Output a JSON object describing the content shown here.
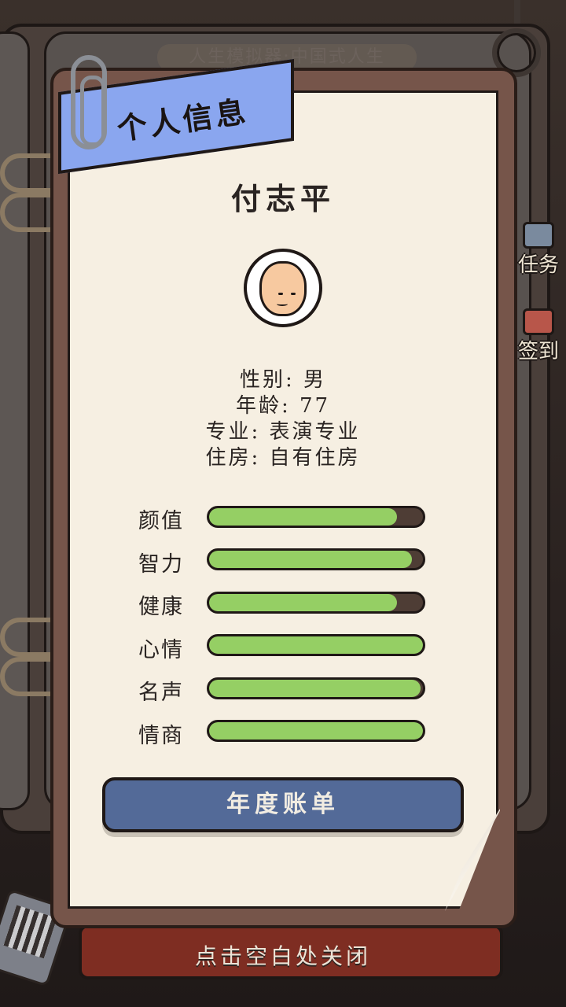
{
  "background": {
    "game_title": "人生模拟器:中国式人生",
    "side_buttons": [
      {
        "label": "任务",
        "icon": "clipboard-icon"
      },
      {
        "label": "签到",
        "icon": "pencil-icon"
      }
    ],
    "close_hint": "点击空白处关闭"
  },
  "panel": {
    "title": "个人信息",
    "name": "付志平",
    "avatar": "old-man-avatar-icon",
    "info": [
      {
        "label": "性别:",
        "value": "男"
      },
      {
        "label": "年龄:",
        "value": "77"
      },
      {
        "label": "专业:",
        "value": "表演专业"
      },
      {
        "label": "住房:",
        "value": "自有住房"
      }
    ],
    "stats": [
      {
        "label": "颜值",
        "value": 0.88
      },
      {
        "label": "智力",
        "value": 0.95
      },
      {
        "label": "健康",
        "value": 0.88
      },
      {
        "label": "心情",
        "value": 1.0
      },
      {
        "label": "名声",
        "value": 0.99
      },
      {
        "label": "情商",
        "value": 1.0
      }
    ],
    "annual_bill_button": "年度账单"
  },
  "colors": {
    "bar_fill": "#95cf64",
    "bar_track": "#4e3d35",
    "banner": "#8aa6ef",
    "button": "#536a98",
    "paper": "#f6efe2"
  }
}
